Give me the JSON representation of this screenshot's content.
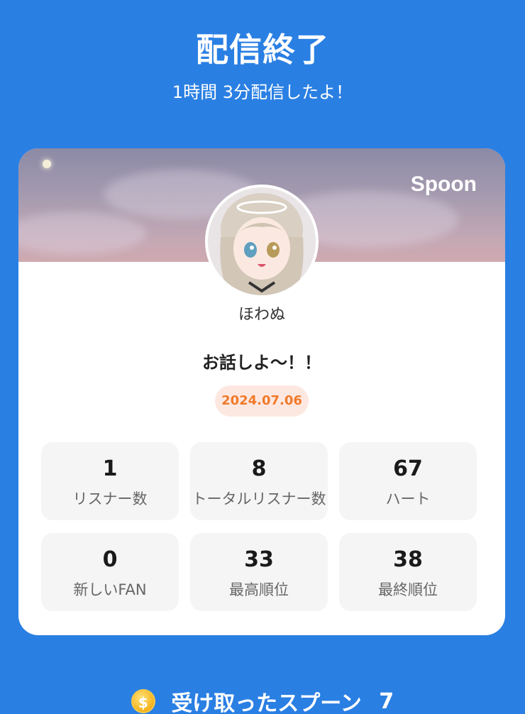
{
  "header": {
    "title": "配信終了",
    "subtitle": "1時間 3分配信したよ！"
  },
  "card": {
    "brand": "Spoon",
    "username": "ほわぬ",
    "broadcast_title": "お話しよ〜！！",
    "date": "2024.07.06",
    "stats": [
      {
        "value": "1",
        "label": "リスナー数"
      },
      {
        "value": "8",
        "label": "トータルリスナー数"
      },
      {
        "value": "67",
        "label": "ハート"
      },
      {
        "value": "0",
        "label": "新しいFAN"
      },
      {
        "value": "33",
        "label": "最高順位"
      },
      {
        "value": "38",
        "label": "最終順位"
      }
    ]
  },
  "footer": {
    "coin_symbol": "$",
    "spoons_label": "受け取ったスプーン",
    "spoons_count": "7"
  },
  "colors": {
    "background": "#2a7fe3",
    "date_badge_bg": "#fde8e1",
    "date_badge_text": "#f07a2a"
  }
}
